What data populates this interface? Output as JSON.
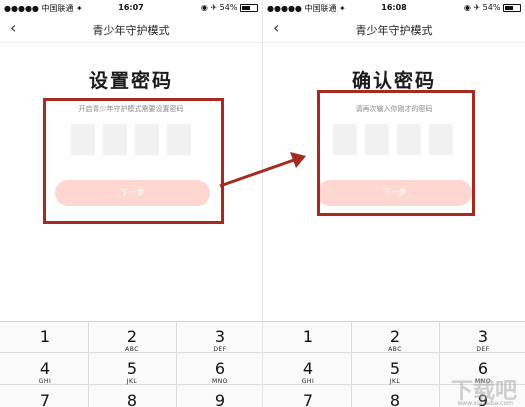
{
  "left": {
    "status": {
      "carrier": "●●●●● 中国联通 ✦",
      "time": "16:07",
      "battery": "◉ ✈ 54%"
    },
    "nav": {
      "title": "青少年守护模式"
    },
    "heading": "设置密码",
    "hint": "开启青少年守护模式需要设置密码",
    "next_label": "下一步"
  },
  "right": {
    "status": {
      "carrier": "●●●●● 中国联通 ✦",
      "time": "16:08",
      "battery": "◉ ✈ 54%"
    },
    "nav": {
      "title": "青少年守护模式"
    },
    "heading": "确认密码",
    "hint": "请再次输入你刚才的密码",
    "next_label": "下一步"
  },
  "keypad": {
    "keys": [
      {
        "num": "1",
        "letters": ""
      },
      {
        "num": "2",
        "letters": "ABC"
      },
      {
        "num": "3",
        "letters": "DEF"
      },
      {
        "num": "4",
        "letters": "GHI"
      },
      {
        "num": "5",
        "letters": "JKL"
      },
      {
        "num": "6",
        "letters": "MNO"
      },
      {
        "num": "7",
        "letters": ""
      },
      {
        "num": "8",
        "letters": ""
      },
      {
        "num": "9",
        "letters": ""
      }
    ]
  },
  "watermark": {
    "text": "下载吧",
    "url": "www.xiazaiba.com"
  },
  "colors": {
    "accent_button": "#fdd7d0",
    "highlight": "#a8291f"
  }
}
